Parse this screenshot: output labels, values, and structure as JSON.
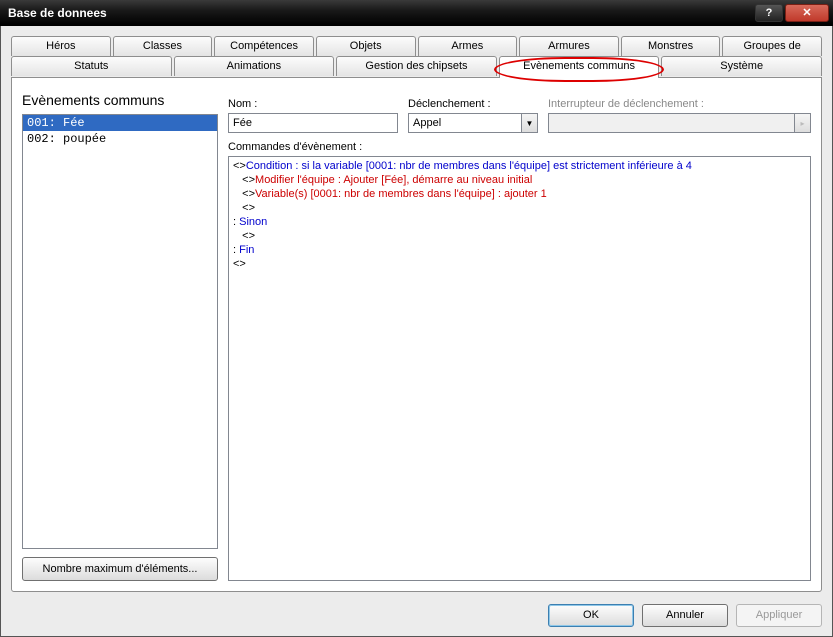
{
  "window": {
    "title": "Base de donnees"
  },
  "tabs": {
    "row1": [
      "Héros",
      "Classes",
      "Compétences",
      "Objets",
      "Armes",
      "Armures",
      "Monstres",
      "Groupes de monstres"
    ],
    "row2": [
      "Statuts",
      "Animations",
      "Gestion des chipsets",
      "Evènements communs",
      "Système"
    ],
    "activeIndex": 3
  },
  "left": {
    "heading": "Evènements communs",
    "items": [
      "001: Fée",
      "002: poupée"
    ],
    "selectedIndex": 0,
    "maxButton": "Nombre maximum d'éléments..."
  },
  "fields": {
    "name": {
      "label": "Nom :",
      "value": "Fée"
    },
    "trigger": {
      "label": "Déclenchement :",
      "value": "Appel"
    },
    "switch": {
      "label": "Interrupteur de déclenchement :",
      "value": ""
    }
  },
  "commands": {
    "label": "Commandes d'évènement :",
    "lines": [
      {
        "indent": 0,
        "marker": "<>",
        "color": "blue",
        "text": "Condition : si la variable [0001: nbr de membres dans l'équipe] est strictement inférieure à 4"
      },
      {
        "indent": 1,
        "marker": "<>",
        "color": "red",
        "text": "Modifier l'équipe : Ajouter [Fée], démarre au niveau initial"
      },
      {
        "indent": 1,
        "marker": "<>",
        "color": "red",
        "text": "Variable(s) [0001: nbr de membres dans l'équipe] : ajouter 1"
      },
      {
        "indent": 1,
        "marker": "<>",
        "color": "black",
        "text": ""
      },
      {
        "indent": 0,
        "marker": ":",
        "color": "blue",
        "text": " Sinon"
      },
      {
        "indent": 1,
        "marker": "<>",
        "color": "black",
        "text": ""
      },
      {
        "indent": 0,
        "marker": ":",
        "color": "blue",
        "text": " Fin"
      },
      {
        "indent": 0,
        "marker": "<>",
        "color": "black",
        "text": ""
      }
    ]
  },
  "footer": {
    "ok": "OK",
    "cancel": "Annuler",
    "apply": "Appliquer"
  }
}
